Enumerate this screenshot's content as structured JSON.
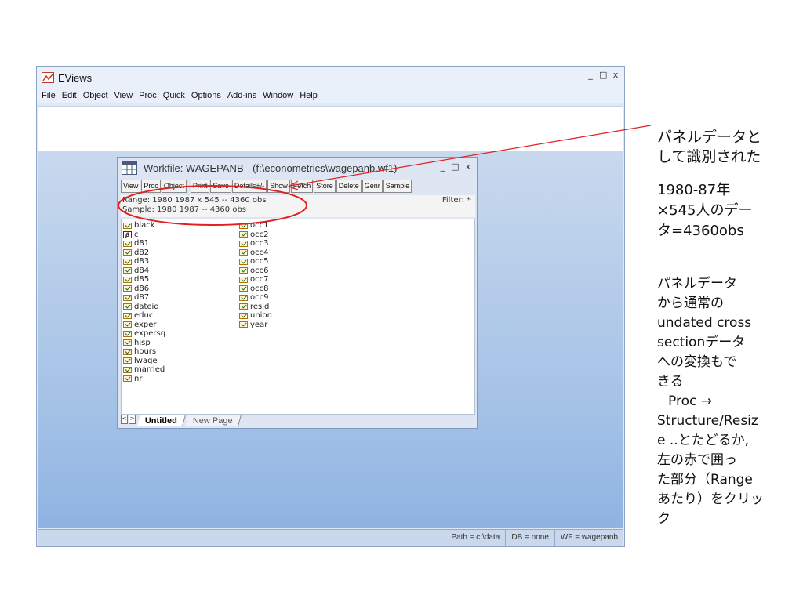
{
  "app": {
    "title": "EViews",
    "window_controls": [
      "_",
      "□",
      "x"
    ],
    "menu": [
      "File",
      "Edit",
      "Object",
      "View",
      "Proc",
      "Quick",
      "Options",
      "Add-ins",
      "Window",
      "Help"
    ]
  },
  "workfile": {
    "title": "Workfile: WAGEPANB - (f:\\econometrics\\wagepanb.wf1)",
    "toolbar": [
      "View",
      "Proc",
      "Object",
      "Print",
      "Save",
      "Details+/-",
      "Show",
      "Fetch",
      "Store",
      "Delete",
      "Genr",
      "Sample"
    ],
    "range": "Range:  1980 1987 x 545   --   4360 obs",
    "sample": "Sample: 1980 1987   --   4360 obs",
    "filter": "Filter: *",
    "col1": [
      "black",
      "c",
      "d81",
      "d82",
      "d83",
      "d84",
      "d85",
      "d86",
      "d87",
      "dateid",
      "educ",
      "exper",
      "expersq",
      "hisp",
      "hours",
      "lwage",
      "married",
      "nr"
    ],
    "col2": [
      "occ1",
      "occ2",
      "occ3",
      "occ4",
      "occ5",
      "occ6",
      "occ7",
      "occ8",
      "occ9",
      "resid",
      "union",
      "year"
    ],
    "tabs": {
      "active": "Untitled",
      "other": "New Page",
      "nav": [
        "<",
        ">"
      ]
    }
  },
  "statusbar": {
    "path": "Path = c:\\data",
    "db": "DB = none",
    "wf": "WF = wagepanb"
  },
  "notes": {
    "n1": [
      "パネルデータと",
      "して識別された"
    ],
    "n2": [
      "1980-87年",
      "×545人のデー",
      "タ=4360obs"
    ],
    "n3": [
      "パネルデータ",
      "から通常の",
      "undated cross",
      "sectionデータ",
      "への変換もで",
      "きる",
      "Proc →",
      "Structure/Resiz",
      "e ..とたどるか,",
      "左の赤で囲っ",
      "た部分（Range",
      "あたり）をクリッ",
      "ク"
    ]
  },
  "colors": {
    "annotation_red": "#e02020",
    "desktop_blue": "#a3c1e6"
  }
}
